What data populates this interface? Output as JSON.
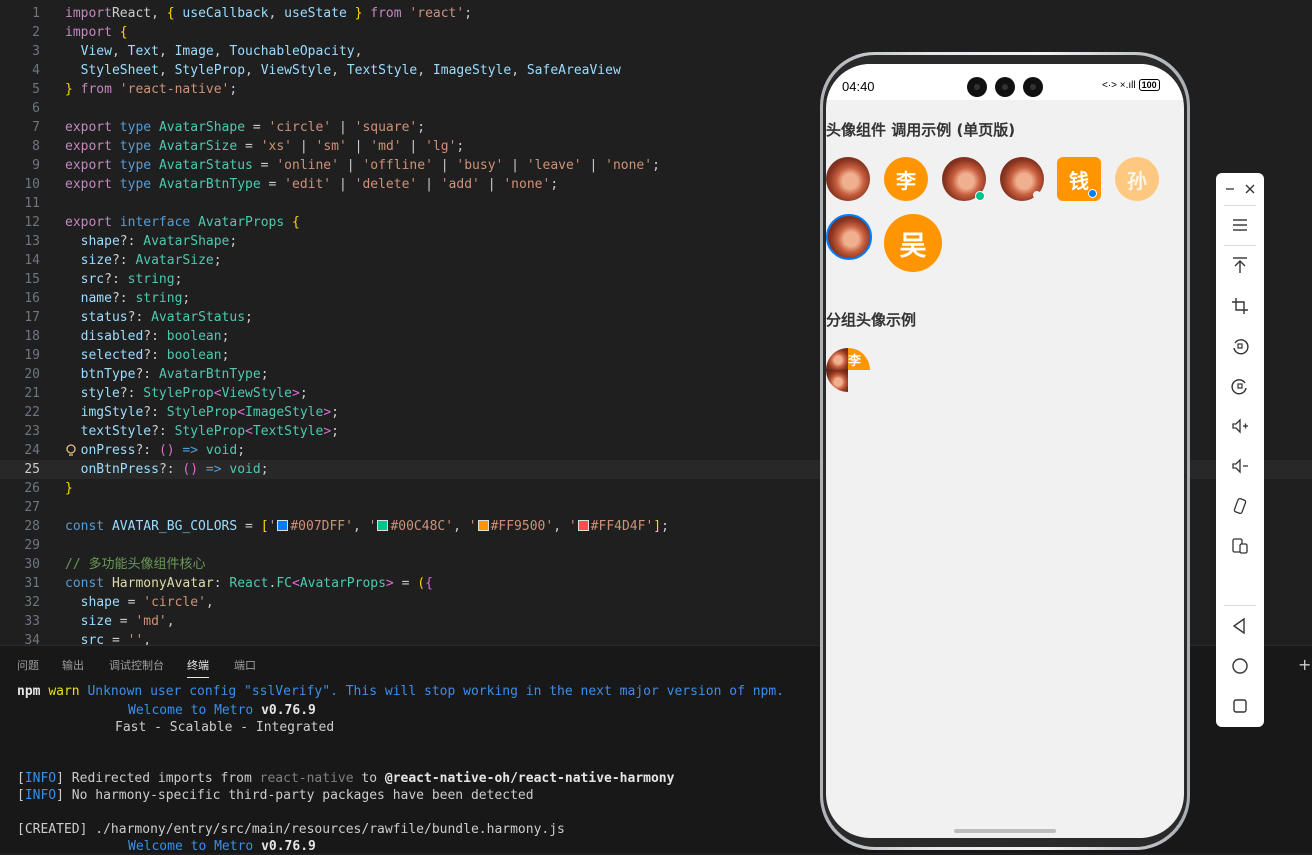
{
  "editor": {
    "lines": [
      {
        "n": "1",
        "segs": [
          [
            "kw",
            "import"
          ],
          [
            "",
            "React, "
          ],
          [
            "br",
            "{"
          ],
          [
            "id",
            " useCallback"
          ],
          [
            "",
            ", "
          ],
          [
            "id",
            "useState "
          ],
          [
            "br",
            "}"
          ],
          [
            "kw",
            " from "
          ],
          [
            "st",
            "'react'"
          ],
          [
            "",
            ";"
          ]
        ]
      },
      {
        "n": "2",
        "segs": [
          [
            "kw",
            "import "
          ],
          [
            "br",
            "{"
          ]
        ]
      },
      {
        "n": "3",
        "segs": [
          [
            "",
            "  "
          ],
          [
            "id",
            "View"
          ],
          [
            "",
            ", "
          ],
          [
            "id",
            "Text"
          ],
          [
            "",
            ", "
          ],
          [
            "id",
            "Image"
          ],
          [
            "",
            ", "
          ],
          [
            "id",
            "TouchableOpacity"
          ],
          [
            "",
            ","
          ]
        ]
      },
      {
        "n": "4",
        "segs": [
          [
            "",
            "  "
          ],
          [
            "id",
            "StyleSheet"
          ],
          [
            "",
            ", "
          ],
          [
            "id",
            "StyleProp"
          ],
          [
            "",
            ", "
          ],
          [
            "id",
            "ViewStyle"
          ],
          [
            "",
            ", "
          ],
          [
            "id",
            "TextStyle"
          ],
          [
            "",
            ", "
          ],
          [
            "id",
            "ImageStyle"
          ],
          [
            "",
            ", "
          ],
          [
            "id",
            "SafeAreaView"
          ]
        ]
      },
      {
        "n": "5",
        "segs": [
          [
            "br",
            "}"
          ],
          [
            "kw",
            " from "
          ],
          [
            "st",
            "'react-native'"
          ],
          [
            "",
            ";"
          ]
        ]
      },
      {
        "n": "6",
        "segs": []
      },
      {
        "n": "7",
        "segs": [
          [
            "kw",
            "export "
          ],
          [
            "kw2",
            "type "
          ],
          [
            "ty",
            "AvatarShape"
          ],
          [
            "",
            " = "
          ],
          [
            "st",
            "'circle'"
          ],
          [
            "",
            " | "
          ],
          [
            "st",
            "'square'"
          ],
          [
            "",
            ";"
          ]
        ]
      },
      {
        "n": "8",
        "segs": [
          [
            "kw",
            "export "
          ],
          [
            "kw2",
            "type "
          ],
          [
            "ty",
            "AvatarSize"
          ],
          [
            "",
            " = "
          ],
          [
            "st",
            "'xs'"
          ],
          [
            "",
            " | "
          ],
          [
            "st",
            "'sm'"
          ],
          [
            "",
            " | "
          ],
          [
            "st",
            "'md'"
          ],
          [
            "",
            " | "
          ],
          [
            "st",
            "'lg'"
          ],
          [
            "",
            ";"
          ]
        ]
      },
      {
        "n": "9",
        "segs": [
          [
            "kw",
            "export "
          ],
          [
            "kw2",
            "type "
          ],
          [
            "ty",
            "AvatarStatus"
          ],
          [
            "",
            " = "
          ],
          [
            "st",
            "'online'"
          ],
          [
            "",
            " | "
          ],
          [
            "st",
            "'offline'"
          ],
          [
            "",
            " | "
          ],
          [
            "st",
            "'busy'"
          ],
          [
            "",
            " | "
          ],
          [
            "st",
            "'leave'"
          ],
          [
            "",
            " | "
          ],
          [
            "st",
            "'none'"
          ],
          [
            "",
            ";"
          ]
        ]
      },
      {
        "n": "10",
        "segs": [
          [
            "kw",
            "export "
          ],
          [
            "kw2",
            "type "
          ],
          [
            "ty",
            "AvatarBtnType"
          ],
          [
            "",
            " = "
          ],
          [
            "st",
            "'edit'"
          ],
          [
            "",
            " | "
          ],
          [
            "st",
            "'delete'"
          ],
          [
            "",
            " | "
          ],
          [
            "st",
            "'add'"
          ],
          [
            "",
            " | "
          ],
          [
            "st",
            "'none'"
          ],
          [
            "",
            ";"
          ]
        ]
      },
      {
        "n": "11",
        "segs": []
      },
      {
        "n": "12",
        "segs": [
          [
            "kw",
            "export "
          ],
          [
            "kw2",
            "interface "
          ],
          [
            "ty",
            "AvatarProps "
          ],
          [
            "br",
            "{"
          ]
        ]
      },
      {
        "n": "13",
        "segs": [
          [
            "",
            "  "
          ],
          [
            "id",
            "shape"
          ],
          [
            "",
            "?: "
          ],
          [
            "ty",
            "AvatarShape"
          ],
          [
            "",
            ";"
          ]
        ]
      },
      {
        "n": "14",
        "segs": [
          [
            "",
            "  "
          ],
          [
            "id",
            "size"
          ],
          [
            "",
            "?: "
          ],
          [
            "ty",
            "AvatarSize"
          ],
          [
            "",
            ";"
          ]
        ]
      },
      {
        "n": "15",
        "segs": [
          [
            "",
            "  "
          ],
          [
            "id",
            "src"
          ],
          [
            "",
            "?: "
          ],
          [
            "ty",
            "string"
          ],
          [
            "",
            ";"
          ]
        ]
      },
      {
        "n": "16",
        "segs": [
          [
            "",
            "  "
          ],
          [
            "id",
            "name"
          ],
          [
            "",
            "?: "
          ],
          [
            "ty",
            "string"
          ],
          [
            "",
            ";"
          ]
        ]
      },
      {
        "n": "17",
        "segs": [
          [
            "",
            "  "
          ],
          [
            "id",
            "status"
          ],
          [
            "",
            "?: "
          ],
          [
            "ty",
            "AvatarStatus"
          ],
          [
            "",
            ";"
          ]
        ]
      },
      {
        "n": "18",
        "segs": [
          [
            "",
            "  "
          ],
          [
            "id",
            "disabled"
          ],
          [
            "",
            "?: "
          ],
          [
            "ty",
            "boolean"
          ],
          [
            "",
            ";"
          ]
        ]
      },
      {
        "n": "19",
        "segs": [
          [
            "",
            "  "
          ],
          [
            "id",
            "selected"
          ],
          [
            "",
            "?: "
          ],
          [
            "ty",
            "boolean"
          ],
          [
            "",
            ";"
          ]
        ]
      },
      {
        "n": "20",
        "segs": [
          [
            "",
            "  "
          ],
          [
            "id",
            "btnType"
          ],
          [
            "",
            "?: "
          ],
          [
            "ty",
            "AvatarBtnType"
          ],
          [
            "",
            ";"
          ]
        ]
      },
      {
        "n": "21",
        "segs": [
          [
            "",
            "  "
          ],
          [
            "id",
            "style"
          ],
          [
            "",
            "?: "
          ],
          [
            "ty",
            "StyleProp"
          ],
          [
            "br2",
            "<"
          ],
          [
            "ty",
            "ViewStyle"
          ],
          [
            "br2",
            ">"
          ],
          [
            "",
            ";"
          ]
        ]
      },
      {
        "n": "22",
        "segs": [
          [
            "",
            "  "
          ],
          [
            "id",
            "imgStyle"
          ],
          [
            "",
            "?: "
          ],
          [
            "ty",
            "StyleProp"
          ],
          [
            "br2",
            "<"
          ],
          [
            "ty",
            "ImageStyle"
          ],
          [
            "br2",
            ">"
          ],
          [
            "",
            ";"
          ]
        ]
      },
      {
        "n": "23",
        "segs": [
          [
            "",
            "  "
          ],
          [
            "id",
            "textStyle"
          ],
          [
            "",
            "?: "
          ],
          [
            "ty",
            "StyleProp"
          ],
          [
            "br2",
            "<"
          ],
          [
            "ty",
            "TextStyle"
          ],
          [
            "br2",
            ">"
          ],
          [
            "",
            ";"
          ]
        ]
      },
      {
        "n": "24",
        "segs": [
          [
            "",
            "  "
          ],
          [
            "id",
            "onPress"
          ],
          [
            "",
            "?: "
          ],
          [
            "br2",
            "()"
          ],
          [
            "kw2",
            " => "
          ],
          [
            "ty",
            "void"
          ],
          [
            "",
            ";"
          ]
        ]
      },
      {
        "n": "25",
        "segs": [
          [
            "",
            "  "
          ],
          [
            "id",
            "onBtnPress"
          ],
          [
            "",
            "?: "
          ],
          [
            "br2",
            "()"
          ],
          [
            "kw2",
            " => "
          ],
          [
            "ty",
            "void"
          ],
          [
            "",
            ";"
          ]
        ]
      },
      {
        "n": "26",
        "segs": [
          [
            "br",
            "}"
          ]
        ]
      },
      {
        "n": "27",
        "segs": []
      },
      {
        "n": "28",
        "segs": [
          [
            "kw2",
            "const "
          ],
          [
            "id",
            "AVATAR_BG_COLORS"
          ],
          [
            "",
            " = "
          ],
          [
            "br",
            "["
          ],
          [
            "st",
            "'"
          ],
          [
            "sw1",
            ""
          ],
          [
            "st",
            "#007DFF'"
          ],
          [
            "",
            ", "
          ],
          [
            "st",
            "'"
          ],
          [
            "sw2",
            ""
          ],
          [
            "st",
            "#00C48C'"
          ],
          [
            "",
            ", "
          ],
          [
            "st",
            "'"
          ],
          [
            "sw3",
            ""
          ],
          [
            "st",
            "#FF9500'"
          ],
          [
            "",
            ", "
          ],
          [
            "st",
            "'"
          ],
          [
            "sw4",
            ""
          ],
          [
            "st",
            "#FF4D4F'"
          ],
          [
            "br",
            "]"
          ],
          [
            "",
            ";"
          ]
        ]
      },
      {
        "n": "29",
        "segs": []
      },
      {
        "n": "30",
        "segs": [
          [
            "cm",
            "// 多功能头像组件核心"
          ]
        ]
      },
      {
        "n": "31",
        "segs": [
          [
            "kw2",
            "const "
          ],
          [
            "fn",
            "HarmonyAvatar"
          ],
          [
            "",
            ": "
          ],
          [
            "ty",
            "React"
          ],
          [
            "",
            "."
          ],
          [
            "ty",
            "FC"
          ],
          [
            "br2",
            "<"
          ],
          [
            "ty",
            "AvatarProps"
          ],
          [
            "br2",
            ">"
          ],
          [
            "",
            " = "
          ],
          [
            "br",
            "("
          ],
          [
            "br2",
            "{"
          ]
        ]
      },
      {
        "n": "32",
        "segs": [
          [
            "",
            "  "
          ],
          [
            "id",
            "shape"
          ],
          [
            "",
            " = "
          ],
          [
            "st",
            "'circle'"
          ],
          [
            "",
            ","
          ]
        ]
      },
      {
        "n": "33",
        "segs": [
          [
            "",
            "  "
          ],
          [
            "id",
            "size"
          ],
          [
            "",
            " = "
          ],
          [
            "st",
            "'md'"
          ],
          [
            "",
            ","
          ]
        ]
      },
      {
        "n": "34",
        "segs": [
          [
            "",
            "  "
          ],
          [
            "id",
            "src"
          ],
          [
            "",
            " = "
          ],
          [
            "st",
            "''"
          ],
          [
            "",
            ","
          ]
        ]
      }
    ],
    "swatches": {
      "sw1": "#007DFF",
      "sw2": "#00C48C",
      "sw3": "#FF9500",
      "sw4": "#FF4D4F"
    },
    "active_line": "25"
  },
  "panel": {
    "tabs": [
      "问题",
      "输出",
      "调试控制台",
      "终端",
      "端口"
    ],
    "active_tab": "终端"
  },
  "terminal": {
    "l1_npm": "npm",
    "l1_warn": "warn",
    "l1_msg": "Unknown user config \"sslVerify\". This will stop working in the next major version of npm.",
    "welcome_a": "Welcome to Metro",
    "welcome_b": "v0.76.9",
    "tagline": "Fast - Scalable - Integrated",
    "info_tag": "INFO",
    "info1_a": "Redirected imports from",
    "info1_b": "react-native",
    "info1_c": "to",
    "info1_d": "@react-native-oh/react-native-harmony",
    "info2": "No harmony-specific third-party packages have been detected",
    "created_tag": "CREATED",
    "created_msg": "./harmony/entry/src/main/resources/rawfile/bundle.harmony.js"
  },
  "phone": {
    "time": "04:40",
    "status_icons": "<·> ×.ıll",
    "battery": "100",
    "section1_title": "头像组件 调用示例 (单页版)",
    "section2_title": "分组头像示例",
    "avatars": {
      "li": "李",
      "qian": "钱",
      "sun": "孙",
      "wu": "吴",
      "group_partial": "李"
    },
    "colors": {
      "orange": "#FF9500",
      "orange_faded": "#FFC880",
      "blue": "#007DFF",
      "green": "#00C48C"
    }
  }
}
